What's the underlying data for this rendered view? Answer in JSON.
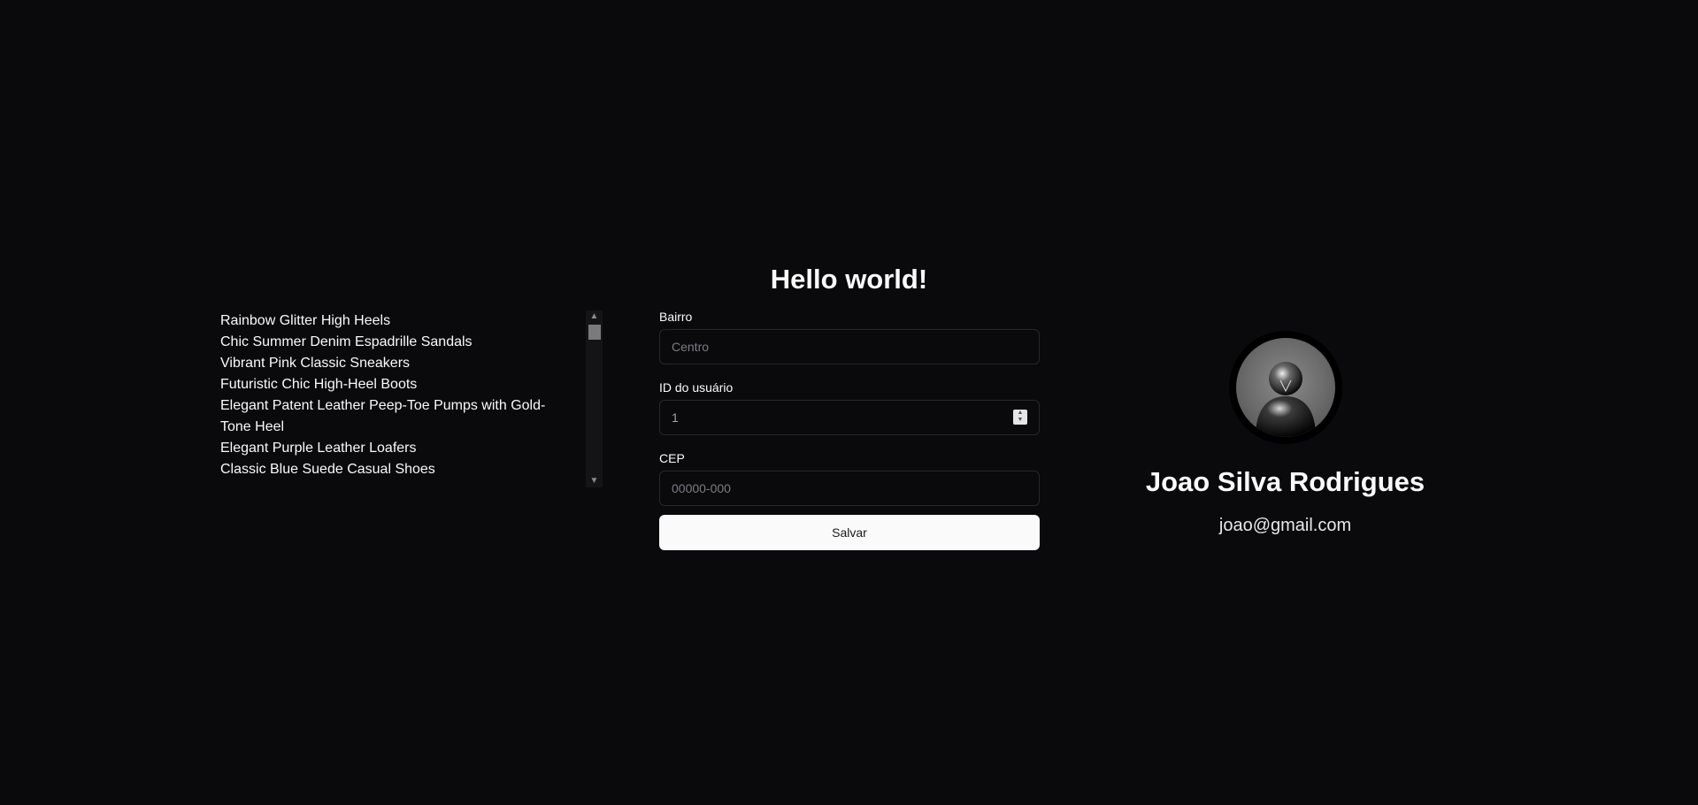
{
  "header": {
    "title": "Hello world!"
  },
  "products": [
    "Rainbow Glitter High Heels",
    "Chic Summer Denim Espadrille Sandals",
    "Vibrant Pink Classic Sneakers",
    "Futuristic Chic High-Heel Boots",
    "Elegant Patent Leather Peep-Toe Pumps with Gold-Tone Heel",
    "Elegant Purple Leather Loafers",
    "Classic Blue Suede Casual Shoes"
  ],
  "form": {
    "bairro": {
      "label": "Bairro",
      "placeholder": "Centro"
    },
    "user_id": {
      "label": "ID do usuário",
      "value": "1"
    },
    "cep": {
      "label": "CEP",
      "placeholder": "00000-000"
    },
    "save_label": "Salvar"
  },
  "profile": {
    "name": "Joao Silva Rodrigues",
    "email": "joao@gmail.com",
    "avatar_icon": "user-avatar-icon"
  },
  "colors": {
    "background": "#0a0a0c",
    "text": "#fafafa",
    "button_bg": "#fafafa",
    "border": "#27272a"
  }
}
